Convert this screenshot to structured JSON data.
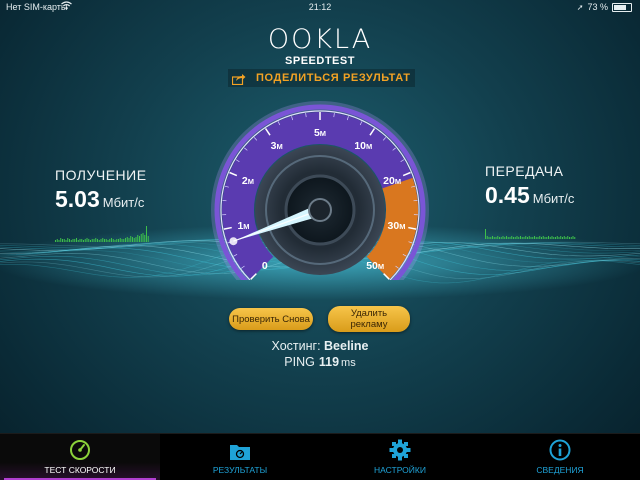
{
  "status_bar": {
    "carrier": "Нет SIM-карты",
    "wifi_icon": "wifi-icon",
    "time": "21:12",
    "battery": "73 %"
  },
  "logo": {
    "brand": "OOKLA",
    "product": "SPEEDTEST"
  },
  "share": {
    "icon": "share-icon",
    "label": "ПОДЕЛИТЬСЯ РЕЗУЛЬТАТ"
  },
  "download": {
    "title": "ПОЛУЧЕНИЕ",
    "value": "5.03",
    "unit": "Мбит/с"
  },
  "upload": {
    "title": "ПЕРЕДАЧА",
    "value": "0.45",
    "unit": "Мбит/с"
  },
  "gauge": {
    "ticks": [
      "0",
      "1M",
      "2M",
      "3M",
      "5M",
      "10M",
      "20M",
      "30M",
      "50M"
    ],
    "current_mbps": 0.45,
    "colors": {
      "outer_ring": "#7a55d6",
      "fill_purple": "#5a3bb0",
      "fill_orange": "#d9771f"
    }
  },
  "buttons": {
    "retest": "Проверить Снова",
    "remove_ads": "Удалить\nрекламу"
  },
  "server": {
    "label": "Хостинг:",
    "name": "Beeline"
  },
  "ping": {
    "label": "PING",
    "value": "119",
    "unit": "ms"
  },
  "tabs": [
    {
      "label": "ТЕСТ СКОРОСТИ",
      "icon": "speedometer-icon",
      "active": true
    },
    {
      "label": "РЕЗУЛЬТАТЫ",
      "icon": "folder-icon",
      "active": false
    },
    {
      "label": "НАСТРОЙКИ",
      "icon": "gear-icon",
      "active": false
    },
    {
      "label": "СВЕДЕНИЯ",
      "icon": "info-icon",
      "active": false
    }
  ],
  "colors": {
    "accent_orange": "#f2a224",
    "tab_blue": "#1fa3d8",
    "active_tab": "#b13fd1",
    "spark_green": "#3dbf4a"
  }
}
